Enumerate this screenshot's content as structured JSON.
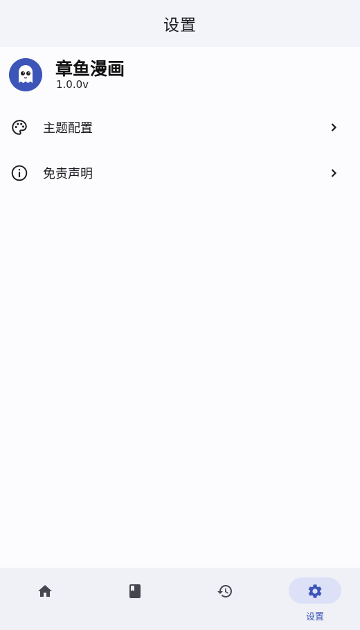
{
  "appbar": {
    "title": "设置"
  },
  "profile": {
    "name": "章鱼漫画",
    "version": "1.0.0v",
    "avatar_icon": "octopus-logo"
  },
  "menu": [
    {
      "label": "主题配置",
      "icon": "palette-icon"
    },
    {
      "label": "免责声明",
      "icon": "info-icon"
    }
  ],
  "nav": [
    {
      "label": "",
      "icon": "home-icon"
    },
    {
      "label": "",
      "icon": "book-icon"
    },
    {
      "label": "",
      "icon": "history-icon"
    },
    {
      "label": "设置",
      "icon": "gear-icon",
      "active": true
    }
  ],
  "colors": {
    "accent": "#3d55b8",
    "active_pill": "#dce1f8",
    "nav_bg": "#f0f1f6"
  }
}
